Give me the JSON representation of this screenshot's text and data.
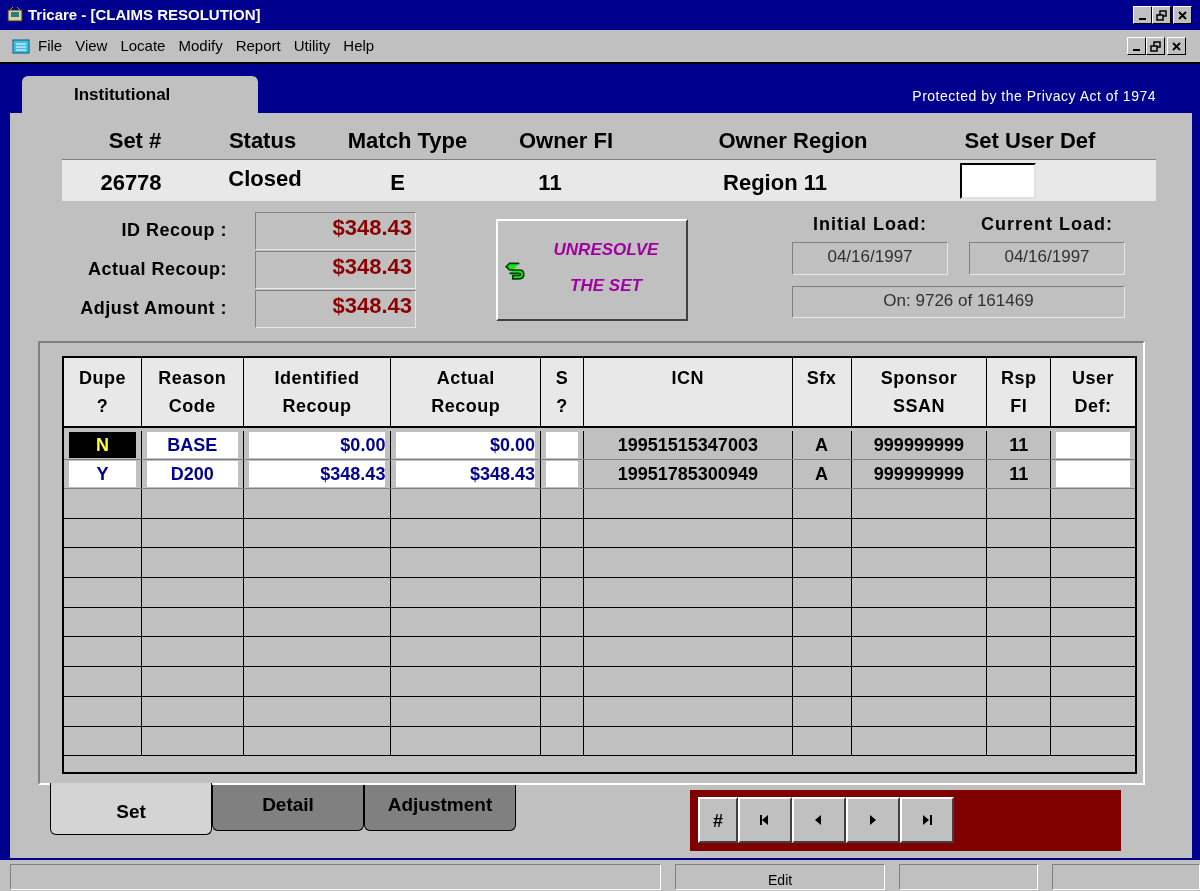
{
  "window": {
    "title": "Tricare - [CLAIMS RESOLUTION]"
  },
  "menu": [
    "File",
    "View",
    "Locate",
    "Modify",
    "Report",
    "Utility",
    "Help"
  ],
  "top_tabs": [
    {
      "label": "Institutional",
      "selected": true
    }
  ],
  "privacy_notice": "Protected by the Privacy Act of 1974",
  "set_header": {
    "labels": [
      "Set #",
      "Status",
      "Match Type",
      "Owner FI",
      "Owner Region",
      "Set User Def"
    ],
    "values": [
      "26778",
      "Closed",
      "E",
      "11",
      "Region 11"
    ]
  },
  "recoup": [
    {
      "label": "ID Recoup :",
      "value": "$348.43"
    },
    {
      "label": "Actual Recoup:",
      "value": "$348.43"
    },
    {
      "label": "Adjust Amount :",
      "value": "$348.43"
    }
  ],
  "unresolve_button": {
    "line_1": "UNRESOLVE",
    "line_2": "THE SET"
  },
  "loads": {
    "initial_label": "Initial Load:",
    "initial_value": "04/16/1997",
    "current_label": "Current Load:",
    "current_value": "04/16/1997",
    "position": "On: 9726 of 161469"
  },
  "table": {
    "columns": [
      [
        "Dupe",
        "?"
      ],
      [
        "Reason",
        "Code"
      ],
      [
        "Identified",
        "Recoup"
      ],
      [
        "Actual",
        "Recoup"
      ],
      [
        "S",
        "?"
      ],
      [
        "ICN"
      ],
      [
        "Sfx"
      ],
      [
        "Sponsor",
        "SSAN"
      ],
      [
        "Rsp",
        "FI"
      ],
      [
        "User",
        "Def:"
      ]
    ],
    "rows": [
      {
        "focused": true,
        "dupe": "N",
        "reason_code": "BASE",
        "identified_recoup": "$0.00",
        "actual_recoup": "$0.00",
        "icn": "19951515347003",
        "sfx": "A",
        "sponsor_ssan": "999999999",
        "rsp_fi": "11"
      },
      {
        "focused": false,
        "dupe": "Y",
        "reason_code": "D200",
        "identified_recoup": "$348.43",
        "actual_recoup": "$348.43",
        "icn": "19951785300949",
        "sfx": "A",
        "sponsor_ssan": "999999999",
        "rsp_fi": "11"
      }
    ]
  },
  "bottom_tabs": [
    {
      "label": "Set",
      "selected": true
    },
    {
      "label": "Detail",
      "selected": false
    },
    {
      "label": "Adjustment",
      "selected": false
    }
  ],
  "nav_buttons": [
    {
      "kind": "number",
      "label": "#"
    },
    {
      "kind": "first"
    },
    {
      "kind": "previous"
    },
    {
      "kind": "next"
    },
    {
      "kind": "last"
    }
  ],
  "status_bar": {
    "mode": "Edit"
  }
}
